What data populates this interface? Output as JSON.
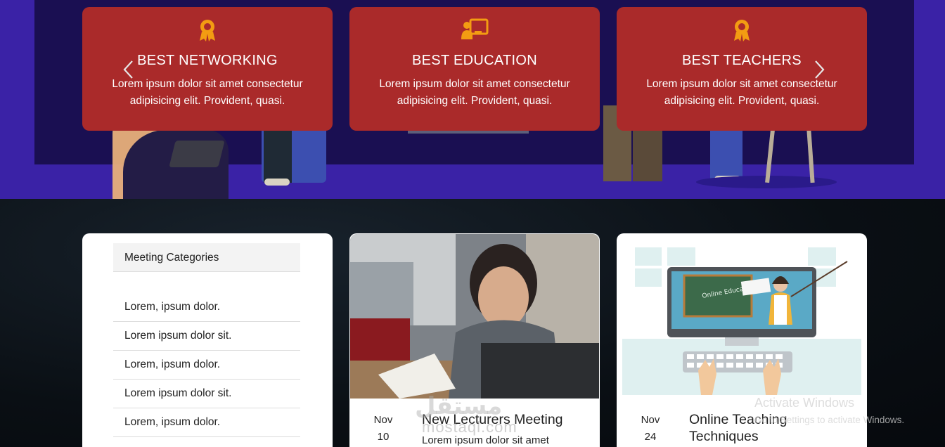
{
  "features": [
    {
      "title": "BEST NETWORKING",
      "desc": "Lorem ipsum dolor sit amet consectetur adipisicing elit. Provident, quasi.",
      "icon": "award-icon"
    },
    {
      "title": "BEST EDUCATION",
      "desc": "Lorem ipsum dolor sit amet consectetur adipisicing elit. Provident, quasi.",
      "icon": "chalkboard-teacher-icon"
    },
    {
      "title": "BEST TEACHERS",
      "desc": "Lorem ipsum dolor sit amet consectetur adipisicing elit. Provident, quasi.",
      "icon": "award-icon"
    }
  ],
  "categories": {
    "header": "Meeting Categories",
    "items": [
      "Lorem, ipsum dolor.",
      "Lorem ipsum dolor sit.",
      "Lorem, ipsum dolor.",
      "Lorem ipsum dolor sit.",
      "Lorem, ipsum dolor."
    ]
  },
  "cards": [
    {
      "month": "Nov",
      "day": "10",
      "title": "New Lecturers Meeting",
      "desc": "Lorem ipsum dolor sit amet"
    },
    {
      "month": "Nov",
      "day": "24",
      "title": "Online Teaching Techniques",
      "desc": "",
      "illustration_text": "Online Education"
    }
  ],
  "watermark": {
    "arabic": "مستقل",
    "latin": "mostaql.com"
  },
  "activation": {
    "line1": "Activate Windows",
    "line2": "Go to Settings to activate Windows."
  },
  "colors": {
    "hero_purple": "#3a22a6",
    "hero_dark": "#1a0f52",
    "feature_red": "#aa2a2a",
    "icon_orange": "#f39c12"
  }
}
